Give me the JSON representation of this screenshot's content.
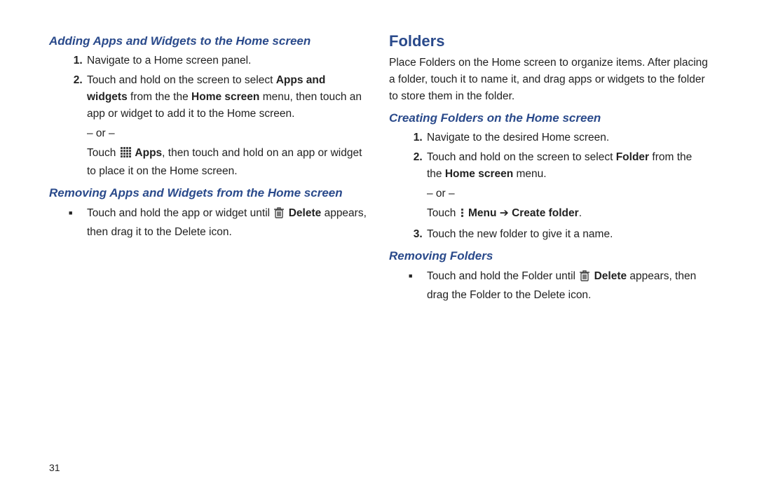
{
  "pageNumber": "31",
  "left": {
    "h1": "Adding Apps and Widgets to the Home screen",
    "steps1": [
      {
        "pre": "Navigate to a Home screen panel."
      },
      {
        "pre": "Touch and hold on the screen to select ",
        "b1": "Apps and widgets",
        "mid1": " from the the ",
        "b2": "Home screen",
        "mid2": " menu, then touch an app or widget to add it to the Home screen.",
        "or": "– or –",
        "alt_pre": "Touch ",
        "alt_b": " Apps",
        "alt_post": ", then touch and hold on an app or widget to place it on the Home screen."
      }
    ],
    "h2": "Removing Apps and Widgets from the Home screen",
    "bullet1_pre": "Touch and hold the app or widget until ",
    "bullet1_b": " Delete",
    "bullet1_post": " appears, then drag it to the Delete icon."
  },
  "right": {
    "title": "Folders",
    "intro": "Place Folders on the Home screen to organize items. After placing a folder, touch it to name it, and drag apps or widgets to the folder to store them in the folder.",
    "h1": "Creating Folders on the Home screen",
    "steps": [
      {
        "pre": "Navigate to the desired Home screen."
      },
      {
        "pre": "Touch and hold on the screen to select ",
        "b1": "Folder",
        "mid1": " from the the ",
        "b2": "Home screen",
        "mid2": " menu.",
        "or": "– or –",
        "alt_pre": "Touch ",
        "alt_b1": " Menu",
        "alt_arrow": " ➔ ",
        "alt_b2": "Create folder",
        "alt_post": "."
      },
      {
        "pre": "Touch the new folder to give it a name."
      }
    ],
    "h2": "Removing Folders",
    "bullet_pre": "Touch and hold the Folder until ",
    "bullet_b": " Delete",
    "bullet_post": " appears, then drag the Folder to the Delete icon."
  }
}
